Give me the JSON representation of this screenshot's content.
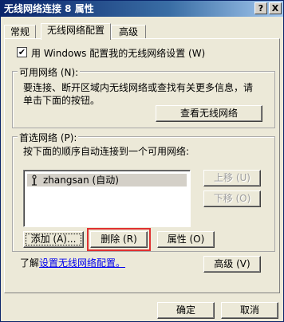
{
  "window": {
    "title": "无线网络连接 8 属性",
    "help_button": "?",
    "close_button": "X"
  },
  "tabs": [
    {
      "label": "常规"
    },
    {
      "label": "无线网络配置"
    },
    {
      "label": "高级"
    }
  ],
  "config": {
    "use_windows_label": "用 Windows 配置我的无线网络设置 (W)"
  },
  "available": {
    "title": "可用网络 (N):",
    "line1": "要连接、断开区域内无线网络或查找有关更多信息，请",
    "line2": "单击下面的按钮。",
    "view_button": "查看无线网络"
  },
  "preferred": {
    "title": "首选网络 (P):",
    "description": "按下面的顺序自动连接到一个可用网络:",
    "networks": [
      {
        "name": "zhangsan (自动)"
      }
    ],
    "move_up": "上移 (U)",
    "move_down": "下移 (O)",
    "add": "添加 (A)...",
    "delete": "删除 (R)",
    "properties": "属性 (O)"
  },
  "learn": {
    "prefix": "了解",
    "link": "设置无线网络配置。"
  },
  "advanced_button": "高级 (V)",
  "ok_button": "确定",
  "cancel_button": "取消",
  "highlight_color": "#e03030"
}
